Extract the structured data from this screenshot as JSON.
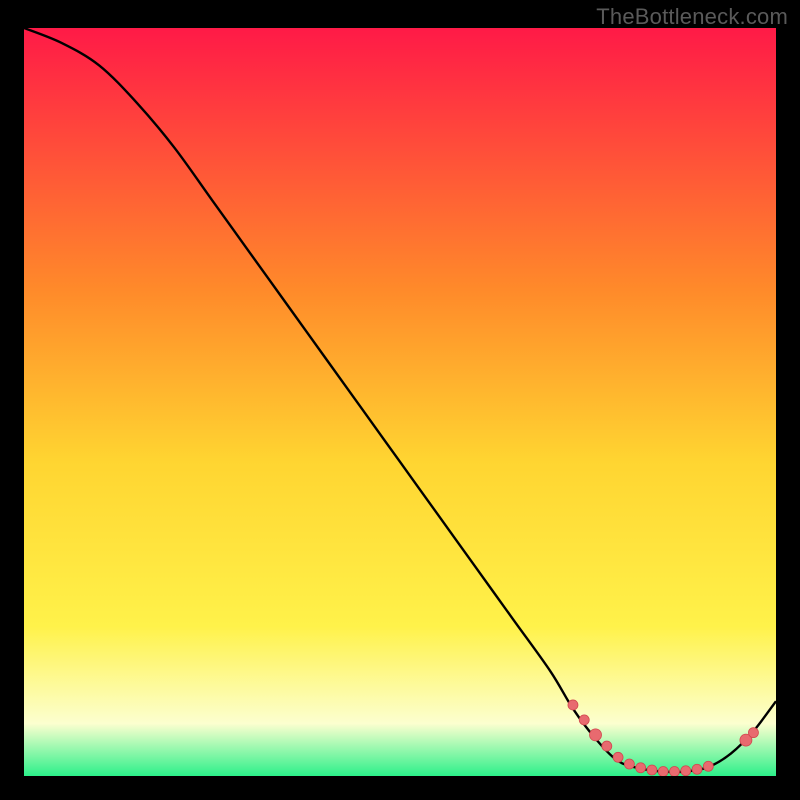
{
  "watermark": "TheBottleneck.com",
  "colors": {
    "background": "#000000",
    "gradient_top": "#ff1a47",
    "gradient_mid_upper": "#ff8a2a",
    "gradient_mid": "#ffd531",
    "gradient_mid_lower": "#fff24a",
    "gradient_pale": "#fcffcf",
    "gradient_green": "#2cf08a",
    "curve": "#000000",
    "marker_fill": "#e86a6f",
    "marker_stroke": "#d1484e"
  },
  "chart_data": {
    "type": "line",
    "title": "",
    "xlabel": "",
    "ylabel": "",
    "xlim": [
      0,
      100
    ],
    "ylim": [
      0,
      100
    ],
    "series": [
      {
        "name": "curve",
        "x": [
          0,
          5,
          10,
          15,
          20,
          25,
          30,
          35,
          40,
          45,
          50,
          55,
          60,
          65,
          70,
          73,
          76,
          79,
          82,
          85,
          88,
          91,
          94,
          97,
          100
        ],
        "y": [
          100,
          98,
          95,
          90,
          84,
          77,
          70,
          63,
          56,
          49,
          42,
          35,
          28,
          21,
          14,
          9,
          5,
          2,
          1,
          0.6,
          0.6,
          1.2,
          3,
          6,
          10
        ]
      }
    ],
    "markers": [
      {
        "x": 73.0,
        "y": 9.5,
        "r": 5
      },
      {
        "x": 74.5,
        "y": 7.5,
        "r": 5
      },
      {
        "x": 76.0,
        "y": 5.5,
        "r": 6
      },
      {
        "x": 77.5,
        "y": 4.0,
        "r": 5
      },
      {
        "x": 79.0,
        "y": 2.5,
        "r": 5
      },
      {
        "x": 80.5,
        "y": 1.6,
        "r": 5
      },
      {
        "x": 82.0,
        "y": 1.1,
        "r": 5
      },
      {
        "x": 83.5,
        "y": 0.8,
        "r": 5
      },
      {
        "x": 85.0,
        "y": 0.6,
        "r": 5
      },
      {
        "x": 86.5,
        "y": 0.6,
        "r": 5
      },
      {
        "x": 88.0,
        "y": 0.7,
        "r": 5
      },
      {
        "x": 89.5,
        "y": 0.9,
        "r": 5
      },
      {
        "x": 91.0,
        "y": 1.3,
        "r": 5
      },
      {
        "x": 96.0,
        "y": 4.8,
        "r": 6
      },
      {
        "x": 97.0,
        "y": 5.8,
        "r": 5
      }
    ]
  }
}
